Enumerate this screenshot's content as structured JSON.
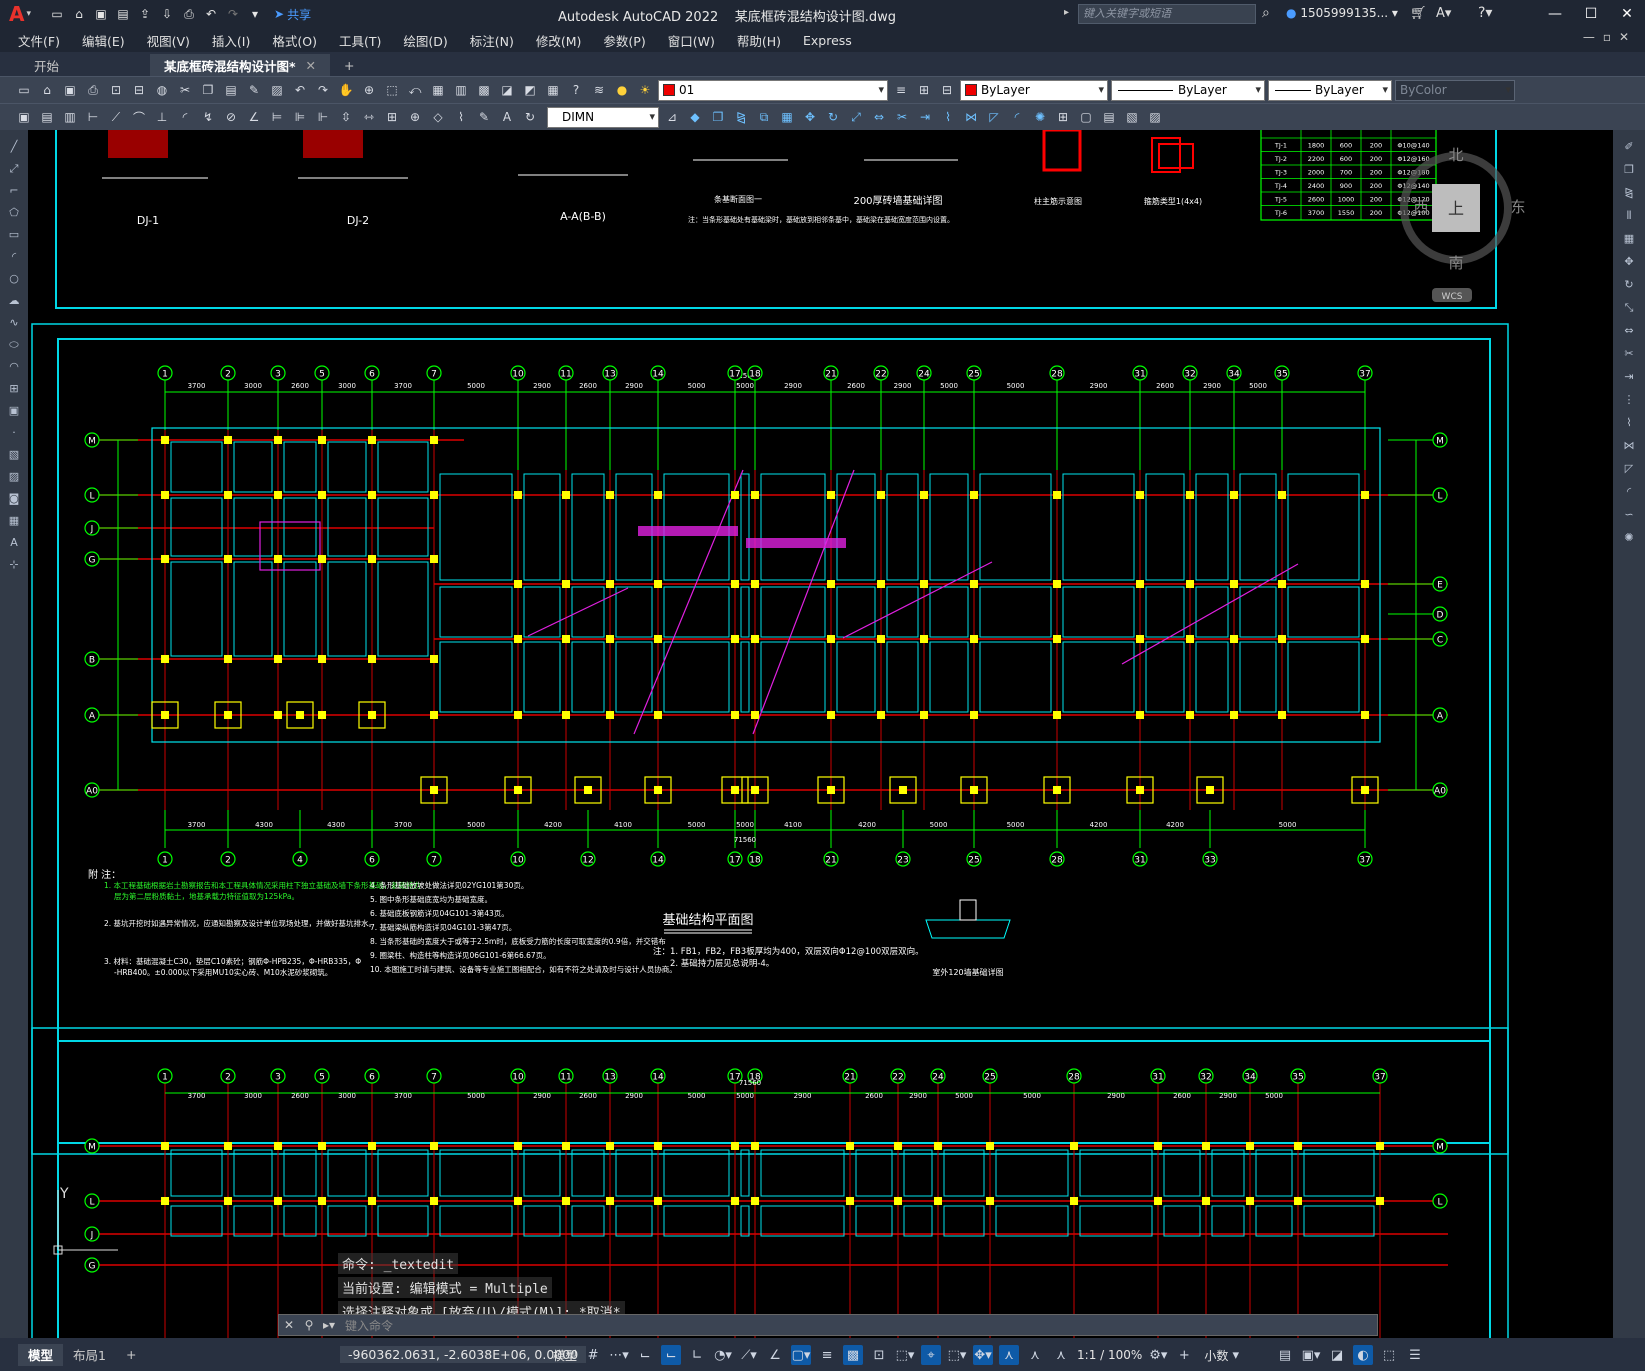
{
  "app": {
    "title": "Autodesk AutoCAD 2022",
    "file": "某底框砖混结构设计图.dwg",
    "search_placeholder": "键入关键字或短语",
    "user": "1505999135...",
    "share": "共享"
  },
  "menu": [
    "文件(F)",
    "编辑(E)",
    "视图(V)",
    "插入(I)",
    "格式(O)",
    "工具(T)",
    "绘图(D)",
    "标注(N)",
    "修改(M)",
    "参数(P)",
    "窗口(W)",
    "帮助(H)",
    "Express"
  ],
  "tabs": {
    "start": "开始",
    "active": "某底框砖混结构设计图*",
    "add": "+"
  },
  "toolbar": {
    "layer": "01",
    "color": "ByLayer",
    "linetype": "ByLayer",
    "lineweight": "ByLayer",
    "plotstyle": "ByColor",
    "dimstyle": "DIMN"
  },
  "viewcube": {
    "north": "北",
    "south": "南",
    "east": "东",
    "west": "西",
    "top": "上",
    "wcs": "WCS"
  },
  "drawing": {
    "top_labels": [
      "DJ-1",
      "DJ-2",
      "A-A(B-B)",
      "条基断面图一",
      "200厚砖墙基础详图",
      "柱主筋示意图",
      "箍筋类型1(4x4)"
    ],
    "top_note": "注：当条形基础处有基础梁时，基础放到相邻条基中，基础梁在基础宽度范围内设置。",
    "table_rows": [
      [
        "TJ-1",
        "1800",
        "600",
        "200",
        "Φ10@140"
      ],
      [
        "TJ-2",
        "2200",
        "600",
        "200",
        "Φ12@160"
      ],
      [
        "TJ-3",
        "2000",
        "700",
        "200",
        "Φ12@180"
      ],
      [
        "TJ-4",
        "2400",
        "900",
        "200",
        "Φ12@140"
      ],
      [
        "TJ-5",
        "2600",
        "1000",
        "200",
        "Φ12@120"
      ],
      [
        "TJ-6",
        "3700",
        "1550",
        "200",
        "Φ12@100"
      ]
    ],
    "axes_top": [
      "1",
      "2",
      "3",
      "5",
      "6",
      "7",
      "10",
      "11",
      "13",
      "14",
      "17",
      "18",
      "21",
      "22",
      "24",
      "25",
      "28",
      "31",
      "32",
      "34",
      "35",
      "37"
    ],
    "axes_bottom": [
      "1",
      "2",
      "4",
      "6",
      "7",
      "10",
      "12",
      "14",
      "17",
      "18",
      "21",
      "23",
      "25",
      "28",
      "31",
      "33",
      "37"
    ],
    "rows_left": [
      "M",
      "L",
      "J",
      "G",
      "B",
      "A",
      "A0"
    ],
    "rows_right": [
      "M",
      "L",
      "E",
      "D",
      "C",
      "A",
      "A0"
    ],
    "dims_top": [
      "3700",
      "3000",
      "2600",
      "3000",
      "3700",
      "5000",
      "2900",
      "2600",
      "2900",
      "5000",
      "5000",
      "2900",
      "2600",
      "2900",
      "5000",
      "5000",
      "2900",
      "2600",
      "2900",
      "5000"
    ],
    "dims_bottom": [
      "3700",
      "4300",
      "4300",
      "3700",
      "5000",
      "4200",
      "4100",
      "5000",
      "5000",
      "4100",
      "4200",
      "5000",
      "5000",
      "4200",
      "4200",
      "5000"
    ],
    "total_dim": "71560",
    "plan_title": "基础结构平面图",
    "notes_title": "附  注：",
    "notes_left": [
      "1. 本工程基础根据岩土勘察报告和本工程具体情况采用柱下独立基础及墙下条形基础，基础持力层为第二层粉质黏土，地基承载力特征值取为125kPa。",
      "2. 基坑开挖时如遇异常情况，应通知勘察及设计单位现场处理，并做好基坑排水。",
      "3. 材料：基础混凝土C30，垫层C10素砼；钢筋Φ-HPB235，Φ-HRB335，Φ-HRB400。±0.000以下采用MU10实心砖、M10水泥砂浆砌筑。"
    ],
    "notes_mid": [
      "4. 条形基础放坡处做法详见02YG101第30页。",
      "5. 图中条形基础底宽均为基础宽度。",
      "6. 基础底板钢筋详见04G101-3第43页。",
      "7. 基础梁纵筋构造详见04G101-3第47页。",
      "8. 当条形基础的宽度大于或等于2.5m时，底板受力筋的长度可取宽度的0.9倍，并交错布置。",
      "9. 圈梁柱、构造柱等构造详见06G101-6第66.67页。",
      "10. 本图施工时请与建筑、设备等专业施工图相配合，如有不符之处请及时与设计人员协商。"
    ],
    "plan_note": [
      "注：1. FB1，FB2，FB3板厚均为400，双层双向Φ12@100双层双向。",
      "2. 基础持力层见总说明-4。"
    ],
    "detail_title": "室外120墙基础详图"
  },
  "command": {
    "lines": [
      "命令: _textedit",
      "当前设置: 编辑模式 = Multiple",
      "选择注释对象或 [放弃(U)/模式(M)]: *取消*"
    ],
    "placeholder": "键入命令"
  },
  "status": {
    "model_tab": "模型",
    "layout_tab": "布局1",
    "add": "+",
    "coords": "-960362.0631, -2.6038E+06, 0.0000",
    "model": "模型",
    "scale": "1:1 / 100%",
    "units": "小数"
  }
}
